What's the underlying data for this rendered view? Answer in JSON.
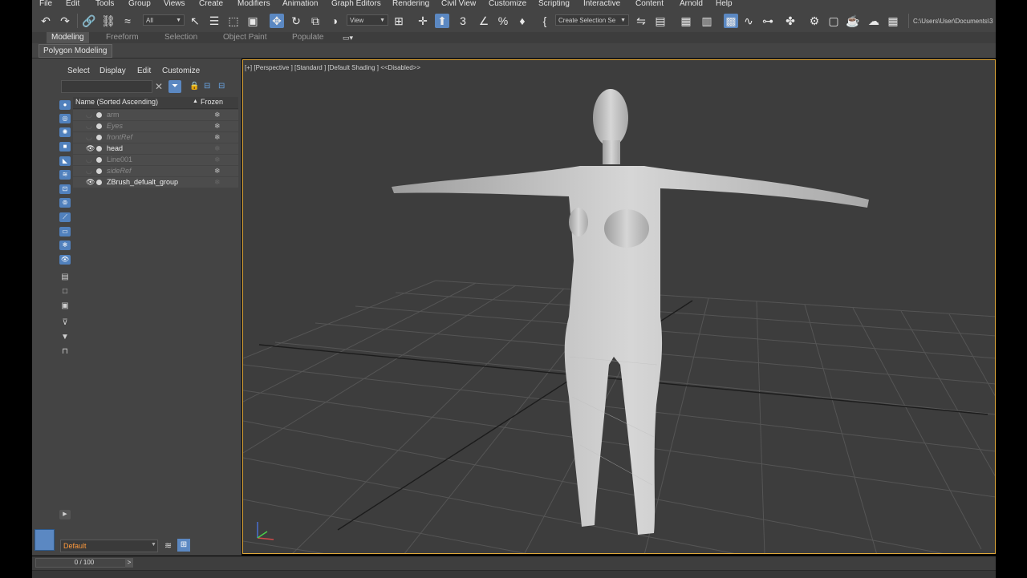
{
  "menubar": {
    "items": [
      "File",
      "Edit",
      "Tools",
      "Group",
      "Views",
      "Create",
      "Modifiers",
      "Animation",
      "Graph Editors",
      "Rendering",
      "Civil View",
      "Customize",
      "Scripting",
      "Interactive",
      "Content",
      "Arnold",
      "Help"
    ]
  },
  "toolbar": {
    "selection_filter": "All",
    "reference_coord": "View",
    "named_selection_set": "Create Selection Se",
    "project_path": "C:\\Users\\User\\Documents\\3"
  },
  "ribbon": {
    "tabs": [
      "Modeling",
      "Freeform",
      "Selection",
      "Object Paint",
      "Populate"
    ],
    "active_tab": "Modeling",
    "panel_label": "Polygon Modeling"
  },
  "scene_explorer": {
    "menus": [
      "Select",
      "Display",
      "Edit",
      "Customize"
    ],
    "search_placeholder": "",
    "column_name": "Name (Sorted Ascending)",
    "column_sort_indicator": "▲",
    "column_frozen": "Frozen",
    "rows": [
      {
        "name": "arm",
        "visible": false,
        "frozen_icon": "❄"
      },
      {
        "name": "Eyes",
        "visible": false,
        "frozen_icon": "❄"
      },
      {
        "name": "frontRef",
        "visible": false,
        "frozen_icon": "❄"
      },
      {
        "name": "head",
        "visible": true,
        "frozen_icon": "❄"
      },
      {
        "name": "Line001",
        "visible": false,
        "frozen_icon": "❄"
      },
      {
        "name": "sideRef",
        "visible": false,
        "frozen_icon": "❄"
      },
      {
        "name": "ZBrush_defualt_group",
        "visible": true,
        "frozen_icon": "❄"
      }
    ],
    "layer": "Default"
  },
  "viewport": {
    "label": "[+] [Perspective ] [Standard ] [Default Shading ]  <<Disabled>>"
  },
  "timeline": {
    "frame_display": "0 / 100",
    "prev": "<",
    "next": ">"
  },
  "colors": {
    "accent": "#5b88c2",
    "viewport_border": "#e0a83b",
    "layer_text": "#ff9a3c"
  }
}
